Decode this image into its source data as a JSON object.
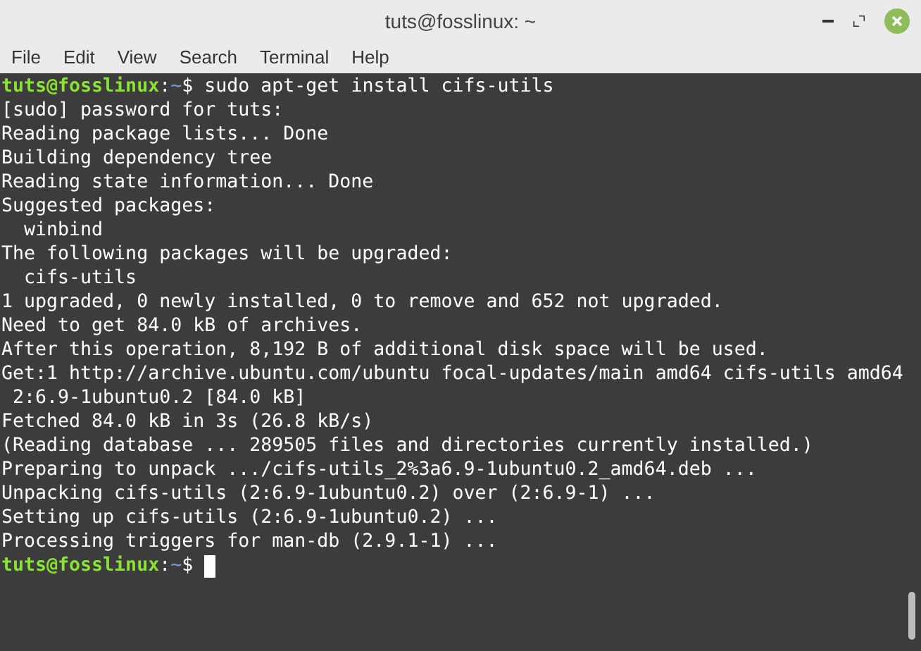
{
  "window": {
    "title": "tuts@fosslinux: ~"
  },
  "menu": [
    "File",
    "Edit",
    "View",
    "Search",
    "Terminal",
    "Help"
  ],
  "terminal": {
    "lines": [
      {
        "kind": "prompt",
        "user_host": "tuts@fosslinux",
        "separator": ":",
        "path": "~",
        "symbol": "$",
        "command": "sudo apt-get install cifs-utils",
        "cursor": false
      },
      {
        "kind": "output",
        "text": "[sudo] password for tuts:"
      },
      {
        "kind": "output",
        "text": "Reading package lists... Done"
      },
      {
        "kind": "output",
        "text": "Building dependency tree"
      },
      {
        "kind": "output",
        "text": "Reading state information... Done"
      },
      {
        "kind": "output",
        "text": "Suggested packages:"
      },
      {
        "kind": "output",
        "text": "  winbind"
      },
      {
        "kind": "output",
        "text": "The following packages will be upgraded:"
      },
      {
        "kind": "output",
        "text": "  cifs-utils"
      },
      {
        "kind": "output",
        "text": "1 upgraded, 0 newly installed, 0 to remove and 652 not upgraded."
      },
      {
        "kind": "output",
        "text": "Need to get 84.0 kB of archives."
      },
      {
        "kind": "output",
        "text": "After this operation, 8,192 B of additional disk space will be used."
      },
      {
        "kind": "output",
        "text": "Get:1 http://archive.ubuntu.com/ubuntu focal-updates/main amd64 cifs-utils amd64"
      },
      {
        "kind": "output",
        "text": " 2:6.9-1ubuntu0.2 [84.0 kB]"
      },
      {
        "kind": "output",
        "text": "Fetched 84.0 kB in 3s (26.8 kB/s)"
      },
      {
        "kind": "output",
        "text": "(Reading database ... 289505 files and directories currently installed.)"
      },
      {
        "kind": "output",
        "text": "Preparing to unpack .../cifs-utils_2%3a6.9-1ubuntu0.2_amd64.deb ..."
      },
      {
        "kind": "output",
        "text": "Unpacking cifs-utils (2:6.9-1ubuntu0.2) over (2:6.9-1) ..."
      },
      {
        "kind": "output",
        "text": "Setting up cifs-utils (2:6.9-1ubuntu0.2) ..."
      },
      {
        "kind": "output",
        "text": "Processing triggers for man-db (2.9.1-1) ..."
      },
      {
        "kind": "prompt",
        "user_host": "tuts@fosslinux",
        "separator": ":",
        "path": "~",
        "symbol": "$",
        "cursor": true
      }
    ]
  }
}
